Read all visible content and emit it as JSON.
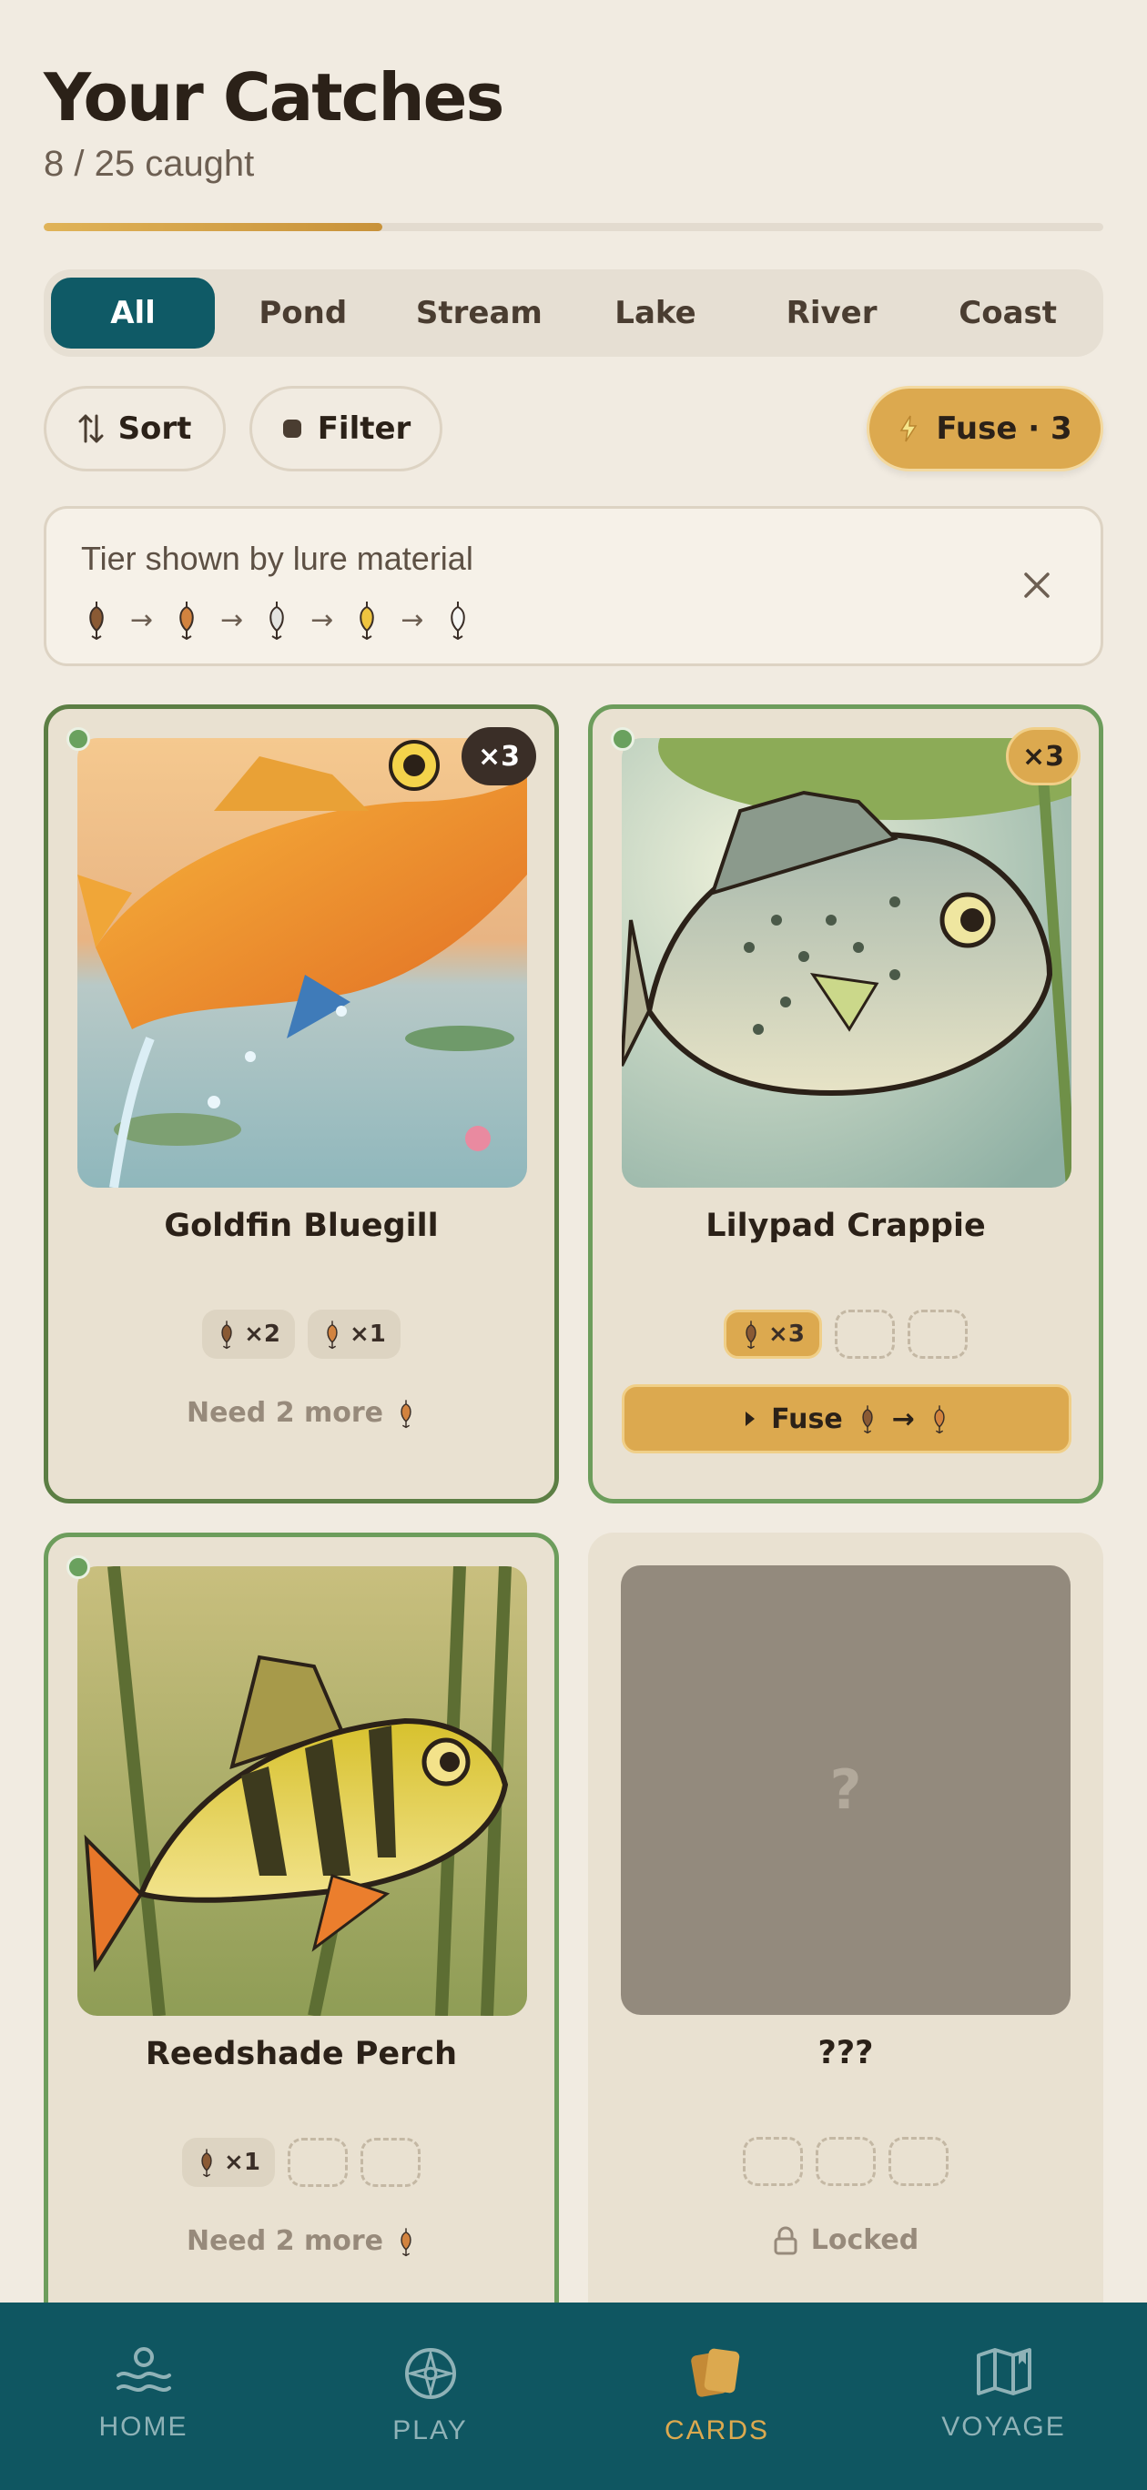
{
  "header": {
    "title": "Your Catches",
    "subtitle": "8 / 25 caught",
    "progress": 0.32
  },
  "tabs": [
    {
      "label": "All",
      "active": true
    },
    {
      "label": "Pond"
    },
    {
      "label": "Stream"
    },
    {
      "label": "Lake"
    },
    {
      "label": "River"
    },
    {
      "label": "Coast"
    }
  ],
  "controls": {
    "sort_label": "Sort",
    "filter_label": "Filter",
    "fuse_label": "Fuse · 3"
  },
  "info": {
    "text": "Tier shown by lure material",
    "tiers": [
      "wood-lure-icon",
      "copper-lure-icon",
      "silver-lure-icon",
      "gold-lure-icon",
      "crystal-lure-icon"
    ]
  },
  "cards": [
    {
      "name": "Goldfin Bluegill",
      "count": "×3",
      "slots": [
        {
          "label": "×2"
        },
        {
          "label": "×1"
        }
      ],
      "status": "Need 2 more"
    },
    {
      "name": "Lilypad Crappie",
      "count": "×3",
      "slots": [
        {
          "label": "×3"
        }
      ],
      "fuse_label": "Fuse"
    },
    {
      "name": "Reedshade Perch",
      "slots": [
        {
          "label": "×1"
        }
      ],
      "status": "Need 2 more"
    },
    {
      "name": "???",
      "status": "Locked",
      "art_label": "?"
    }
  ],
  "nav": [
    {
      "label": "HOME",
      "icon": "home-wave-icon"
    },
    {
      "label": "PLAY",
      "icon": "compass-icon"
    },
    {
      "label": "CARDS",
      "icon": "cards-icon",
      "active": true
    },
    {
      "label": "VOYAGE",
      "icon": "map-icon"
    }
  ],
  "colors": {
    "accent_teal": "#0f5a66",
    "gold": "#dca94f",
    "owned_border": "#6d9d5c"
  }
}
